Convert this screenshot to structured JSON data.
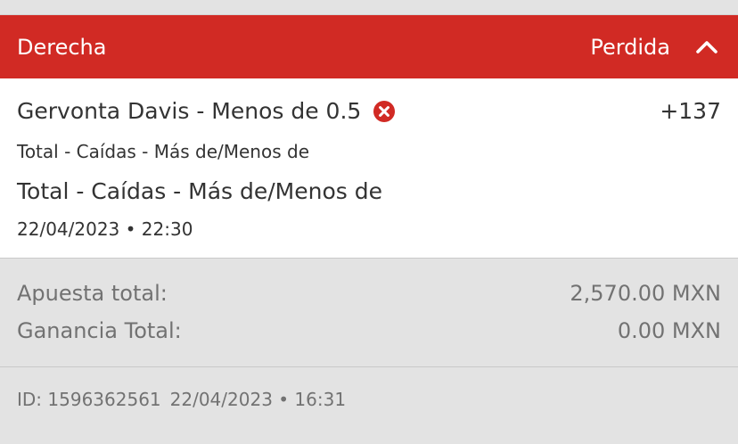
{
  "header": {
    "title": "Derecha",
    "status": "Perdida",
    "accent_color": "#d12a24",
    "collapse_icon": "chevron-up-icon"
  },
  "selection": {
    "name": "Gervonta Davis - Menos de 0.5",
    "result_icon": "lost-x-circle-icon",
    "result_icon_color": "#d12a24",
    "odds": "+137",
    "market_small": "Total - Caídas - Más de/Menos de",
    "market_large": "Total - Caídas - Más de/Menos de",
    "event_datetime": "22/04/2023 • 22:30"
  },
  "totals": {
    "stake_label": "Apuesta total:",
    "stake_value": "2,570.00 MXN",
    "winnings_label": "Ganancia Total:",
    "winnings_value": "0.00 MXN"
  },
  "footer": {
    "bet_id": "ID: 1596362561",
    "placed_datetime": "22/04/2023 • 16:31"
  }
}
